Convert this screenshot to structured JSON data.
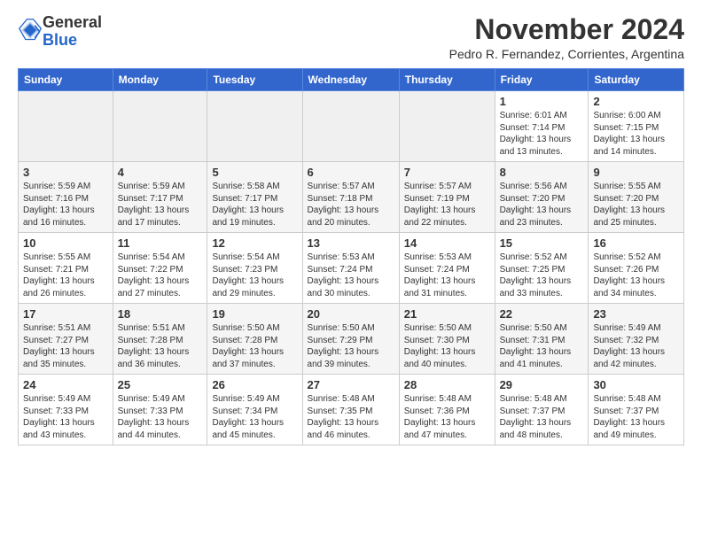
{
  "header": {
    "logo_general": "General",
    "logo_blue": "Blue",
    "month_year": "November 2024",
    "location": "Pedro R. Fernandez, Corrientes, Argentina"
  },
  "weekdays": [
    "Sunday",
    "Monday",
    "Tuesday",
    "Wednesday",
    "Thursday",
    "Friday",
    "Saturday"
  ],
  "weeks": [
    [
      {
        "day": "",
        "info": ""
      },
      {
        "day": "",
        "info": ""
      },
      {
        "day": "",
        "info": ""
      },
      {
        "day": "",
        "info": ""
      },
      {
        "day": "",
        "info": ""
      },
      {
        "day": "1",
        "info": "Sunrise: 6:01 AM\nSunset: 7:14 PM\nDaylight: 13 hours\nand 13 minutes."
      },
      {
        "day": "2",
        "info": "Sunrise: 6:00 AM\nSunset: 7:15 PM\nDaylight: 13 hours\nand 14 minutes."
      }
    ],
    [
      {
        "day": "3",
        "info": "Sunrise: 5:59 AM\nSunset: 7:16 PM\nDaylight: 13 hours\nand 16 minutes."
      },
      {
        "day": "4",
        "info": "Sunrise: 5:59 AM\nSunset: 7:17 PM\nDaylight: 13 hours\nand 17 minutes."
      },
      {
        "day": "5",
        "info": "Sunrise: 5:58 AM\nSunset: 7:17 PM\nDaylight: 13 hours\nand 19 minutes."
      },
      {
        "day": "6",
        "info": "Sunrise: 5:57 AM\nSunset: 7:18 PM\nDaylight: 13 hours\nand 20 minutes."
      },
      {
        "day": "7",
        "info": "Sunrise: 5:57 AM\nSunset: 7:19 PM\nDaylight: 13 hours\nand 22 minutes."
      },
      {
        "day": "8",
        "info": "Sunrise: 5:56 AM\nSunset: 7:20 PM\nDaylight: 13 hours\nand 23 minutes."
      },
      {
        "day": "9",
        "info": "Sunrise: 5:55 AM\nSunset: 7:20 PM\nDaylight: 13 hours\nand 25 minutes."
      }
    ],
    [
      {
        "day": "10",
        "info": "Sunrise: 5:55 AM\nSunset: 7:21 PM\nDaylight: 13 hours\nand 26 minutes."
      },
      {
        "day": "11",
        "info": "Sunrise: 5:54 AM\nSunset: 7:22 PM\nDaylight: 13 hours\nand 27 minutes."
      },
      {
        "day": "12",
        "info": "Sunrise: 5:54 AM\nSunset: 7:23 PM\nDaylight: 13 hours\nand 29 minutes."
      },
      {
        "day": "13",
        "info": "Sunrise: 5:53 AM\nSunset: 7:24 PM\nDaylight: 13 hours\nand 30 minutes."
      },
      {
        "day": "14",
        "info": "Sunrise: 5:53 AM\nSunset: 7:24 PM\nDaylight: 13 hours\nand 31 minutes."
      },
      {
        "day": "15",
        "info": "Sunrise: 5:52 AM\nSunset: 7:25 PM\nDaylight: 13 hours\nand 33 minutes."
      },
      {
        "day": "16",
        "info": "Sunrise: 5:52 AM\nSunset: 7:26 PM\nDaylight: 13 hours\nand 34 minutes."
      }
    ],
    [
      {
        "day": "17",
        "info": "Sunrise: 5:51 AM\nSunset: 7:27 PM\nDaylight: 13 hours\nand 35 minutes."
      },
      {
        "day": "18",
        "info": "Sunrise: 5:51 AM\nSunset: 7:28 PM\nDaylight: 13 hours\nand 36 minutes."
      },
      {
        "day": "19",
        "info": "Sunrise: 5:50 AM\nSunset: 7:28 PM\nDaylight: 13 hours\nand 37 minutes."
      },
      {
        "day": "20",
        "info": "Sunrise: 5:50 AM\nSunset: 7:29 PM\nDaylight: 13 hours\nand 39 minutes."
      },
      {
        "day": "21",
        "info": "Sunrise: 5:50 AM\nSunset: 7:30 PM\nDaylight: 13 hours\nand 40 minutes."
      },
      {
        "day": "22",
        "info": "Sunrise: 5:50 AM\nSunset: 7:31 PM\nDaylight: 13 hours\nand 41 minutes."
      },
      {
        "day": "23",
        "info": "Sunrise: 5:49 AM\nSunset: 7:32 PM\nDaylight: 13 hours\nand 42 minutes."
      }
    ],
    [
      {
        "day": "24",
        "info": "Sunrise: 5:49 AM\nSunset: 7:33 PM\nDaylight: 13 hours\nand 43 minutes."
      },
      {
        "day": "25",
        "info": "Sunrise: 5:49 AM\nSunset: 7:33 PM\nDaylight: 13 hours\nand 44 minutes."
      },
      {
        "day": "26",
        "info": "Sunrise: 5:49 AM\nSunset: 7:34 PM\nDaylight: 13 hours\nand 45 minutes."
      },
      {
        "day": "27",
        "info": "Sunrise: 5:48 AM\nSunset: 7:35 PM\nDaylight: 13 hours\nand 46 minutes."
      },
      {
        "day": "28",
        "info": "Sunrise: 5:48 AM\nSunset: 7:36 PM\nDaylight: 13 hours\nand 47 minutes."
      },
      {
        "day": "29",
        "info": "Sunrise: 5:48 AM\nSunset: 7:37 PM\nDaylight: 13 hours\nand 48 minutes."
      },
      {
        "day": "30",
        "info": "Sunrise: 5:48 AM\nSunset: 7:37 PM\nDaylight: 13 hours\nand 49 minutes."
      }
    ]
  ]
}
